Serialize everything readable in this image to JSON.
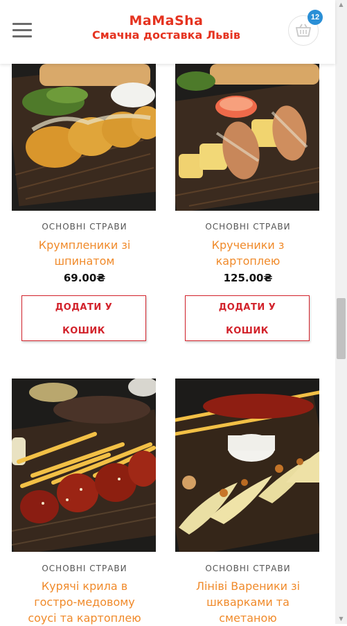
{
  "header": {
    "brand": "MaMaSha",
    "tagline": "Смачна доставка Львів",
    "cart_count": "12",
    "menu_icon": "hamburger-menu-icon",
    "cart_icon": "shopping-basket-icon",
    "brand_color": "#e53320",
    "badge_color": "#2a8fd6"
  },
  "products": [
    {
      "category": "ОСНОВНІ СТРАВИ",
      "title_line1": "Крумпленики зі",
      "title_line2": "шпинатом",
      "price": "69.00₴",
      "button_line1": "ДОДАТИ У",
      "button_line2": "КОШИК"
    },
    {
      "category": "ОСНОВНІ СТРАВИ",
      "title_line1": "Крученики з",
      "title_line2": "картоплею",
      "price": "125.00₴",
      "button_line1": "ДОДАТИ У",
      "button_line2": "КОШИК"
    },
    {
      "category": "ОСНОВНІ СТРАВИ",
      "title_line1": "Курячі крила в",
      "title_line2": "гостро-медовому",
      "title_line3": "соусі та картоплею"
    },
    {
      "category": "ОСНОВНІ СТРАВИ",
      "title_line1": "Лініві Вареники зі",
      "title_line2": "шкварками та",
      "title_line3": "сметаною"
    }
  ],
  "colors": {
    "title": "#f08a2a",
    "button": "#d2222b"
  }
}
